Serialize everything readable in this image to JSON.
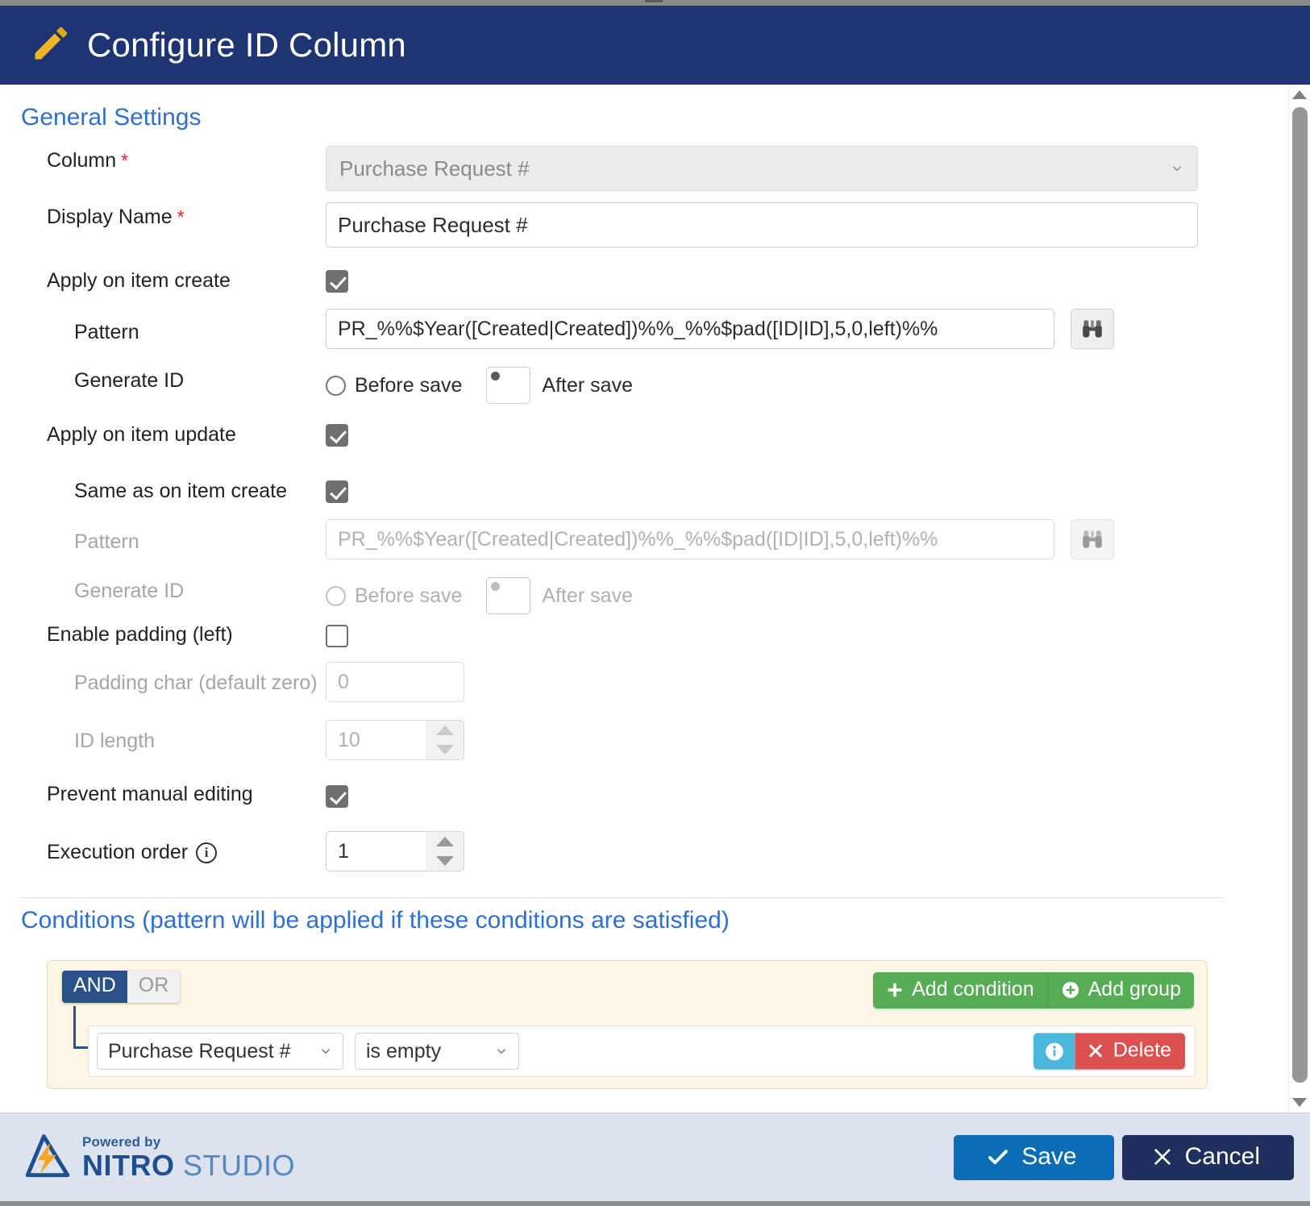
{
  "header": {
    "title": "Configure ID Column",
    "icon": "pencil-icon",
    "bg_color": "#1f3573"
  },
  "general": {
    "section_title": "General Settings",
    "column": {
      "label": "Column",
      "required": "*",
      "value": "Purchase Request #",
      "disabled": true
    },
    "display_name": {
      "label": "Display Name",
      "required": "*",
      "value": "Purchase Request #"
    },
    "apply_on_create": {
      "label": "Apply on item create",
      "checked": true
    },
    "create_pattern": {
      "label": "Pattern",
      "value": "PR_%%$Year([Created|Created])%%_%%$pad([ID|ID],5,0,left)%%",
      "browse_icon": "binoculars-icon"
    },
    "create_generate_id": {
      "label": "Generate ID",
      "options": [
        "Before save",
        "After save"
      ],
      "selected": "After save"
    },
    "apply_on_update": {
      "label": "Apply on item update",
      "checked": true
    },
    "same_as_create": {
      "label": "Same as on item create",
      "checked": true
    },
    "update_pattern": {
      "label": "Pattern",
      "value": "PR_%%$Year([Created|Created])%%_%%$pad([ID|ID],5,0,left)%%",
      "browse_icon": "binoculars-icon",
      "disabled": true
    },
    "update_generate_id": {
      "label": "Generate ID",
      "options": [
        "Before save",
        "After save"
      ],
      "selected": "After save",
      "disabled": true
    },
    "enable_padding": {
      "label": "Enable padding (left)",
      "checked": false
    },
    "padding_char": {
      "label": "Padding char (default zero)",
      "value": "0",
      "disabled": true
    },
    "id_length": {
      "label": "ID length",
      "value": "10",
      "disabled": true
    },
    "prevent_manual_editing": {
      "label": "Prevent manual editing",
      "checked": true
    },
    "execution_order": {
      "label": "Execution order",
      "info_icon": "info-icon",
      "value": "1"
    }
  },
  "conditions": {
    "section_title": "Conditions (pattern will be applied if these conditions are satisfied)",
    "logic": {
      "and_label": "AND",
      "or_label": "OR",
      "selected": "AND"
    },
    "add_condition_label": "Add condition",
    "add_condition_icon": "plus-icon",
    "add_group_label": "Add group",
    "add_group_icon": "plus-circle-icon",
    "rows": [
      {
        "field": "Purchase Request #",
        "operator": "is empty",
        "info_icon": "info-icon",
        "delete_label": "Delete",
        "delete_icon": "x-icon"
      }
    ]
  },
  "footer": {
    "logo": {
      "powered_by": "Powered by",
      "brand_bold": "NITRO",
      "brand_light": " STUDIO",
      "mark": "nitro-bolt-icon"
    },
    "save_label": "Save",
    "save_icon": "check-icon",
    "cancel_label": "Cancel",
    "cancel_icon": "x-icon"
  },
  "scrollbar": {
    "up_icon": "scroll-up-arrow",
    "down_icon": "scroll-down-arrow"
  },
  "colors": {
    "header_blue": "#1f3573",
    "link_blue": "#2f6fd0",
    "green": "#56ad56",
    "red": "#dd5050",
    "info_blue": "#4cb6dd",
    "save_blue": "#0a6db5",
    "cancel_navy": "#20305e",
    "cond_bg": "#fdf6e6"
  }
}
